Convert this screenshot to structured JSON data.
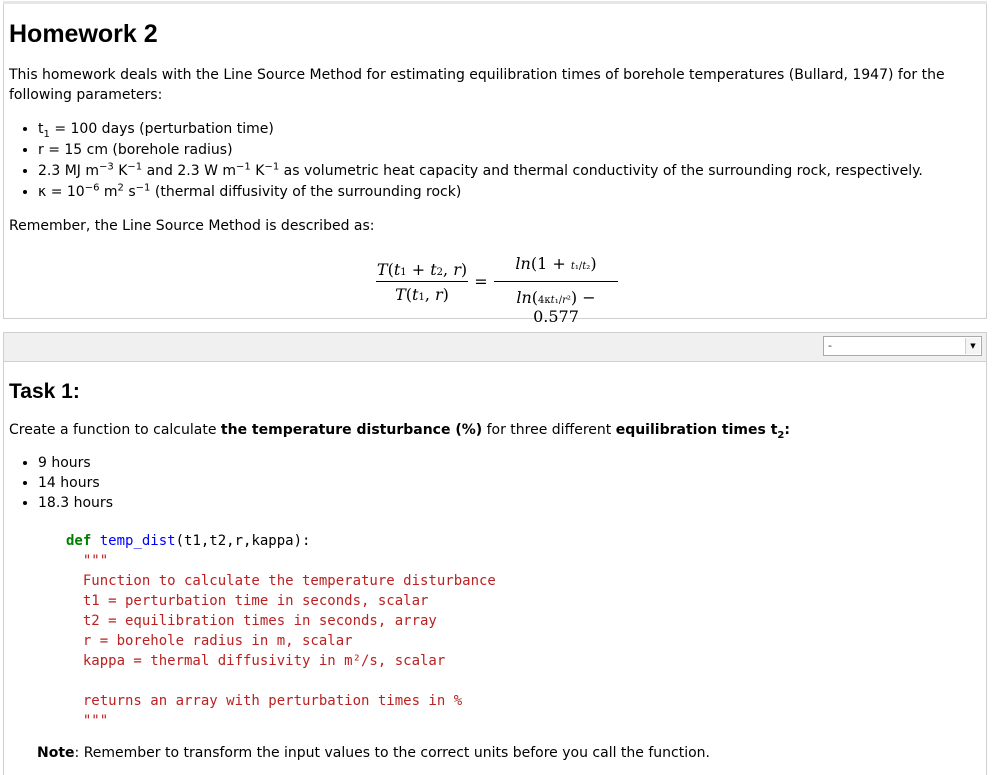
{
  "cell1": {
    "title": "Homework 2",
    "intro": "This homework deals with the Line Source Method for estimating equilibration times of borehole temperatures (Bullard, 1947) for the following parameters:",
    "params": [
      {
        "lead": "t",
        "sub": "1",
        "rest": " = 100 days (perturbation time)"
      },
      {
        "lead": "r = 15 cm (borehole radius)"
      },
      {
        "text": "2.3 MJ m<sup>−3</sup> K<sup>−1</sup> and 2.3 W m<sup>−1</sup> K<sup>−1</sup> as volumetric heat capacity and thermal conductivity of the surrounding rock, respectively."
      },
      {
        "text": "κ = 10<sup>−6</sup> m<sup>2</sup> s<sup>−1</sup> (thermal diffusivity of the surrounding rock)"
      }
    ],
    "remember": "Remember, the Line Source Method is described as:"
  },
  "cell2": {
    "dropdown_value": "-",
    "task_title": "Task 1:",
    "task_text_plain_1": "Create a function to calculate ",
    "task_text_bold_1": "the temperature disturbance (%)",
    "task_text_plain_2": " for three different ",
    "task_text_bold_2": "equilibration times t",
    "task_text_bold_2_sub": "2",
    "task_text_plain_3": ":",
    "times": [
      "9 hours",
      "14 hours",
      "18.3 hours"
    ],
    "code": {
      "def": "def",
      "fname": "temp_dist",
      "args": "(t1,t2,r,kappa):",
      "doc_lines": [
        "\"\"\"",
        "Function to calculate the temperature disturbance",
        "t1 = perturbation time in seconds, scalar",
        "t2 = equilibration times in seconds, array",
        "r = borehole radius in m, scalar",
        "kappa = thermal diffusivity in m²/s, scalar",
        "",
        "returns an array with perturbation times in %",
        "\"\"\""
      ]
    },
    "note_label": "Note",
    "note_text": ": Remember to transform the input values to the correct units before you call the function."
  }
}
